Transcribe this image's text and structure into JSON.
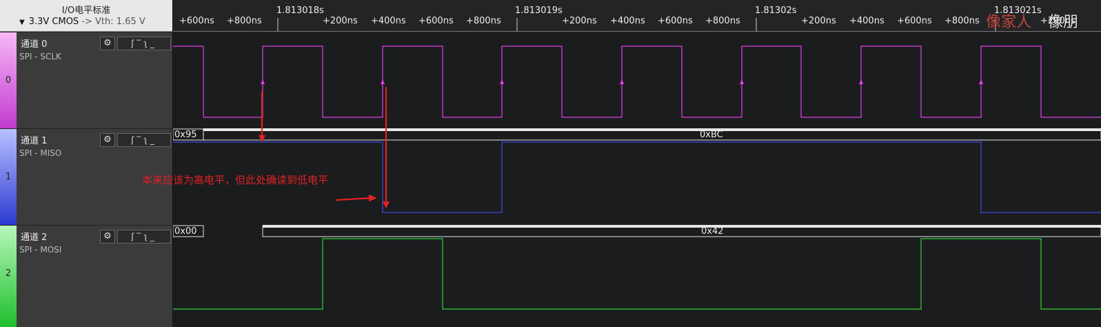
{
  "io_panel": {
    "title": "I/O电平标准",
    "standard": "3.3V CMOS",
    "vth": "-> Vth: 1.65 V"
  },
  "channels": [
    {
      "index": "0",
      "name": "通道 0",
      "signal": "SPI - SCLK",
      "color": "#e040e8"
    },
    {
      "index": "1",
      "name": "通道 1",
      "signal": "SPI - MISO",
      "color": "#3a4de0"
    },
    {
      "index": "2",
      "name": "通道 2",
      "signal": "SPI - MOSI",
      "color": "#2fd43a"
    }
  ],
  "trigger_icons": [
    "rising-edge-icon",
    "high-level-icon",
    "falling-edge-icon",
    "low-level-icon"
  ],
  "ruler": {
    "major": [
      "1.813018s",
      "1.813019s",
      "1.81302s",
      "1.813021s"
    ],
    "minor": [
      "+600ns",
      "+800ns",
      "+200ns",
      "+400ns",
      "+600ns",
      "+800ns",
      "+200ns",
      "+400ns",
      "+600ns",
      "+800ns",
      "+200ns",
      "+400ns",
      "+600ns",
      "+800ns",
      "+200ns"
    ]
  },
  "decoded": {
    "miso": [
      "0x95",
      "0xBC"
    ],
    "mosi": [
      "0x00",
      "0x42"
    ]
  },
  "annotation": "本来应该为高电平，但此处确读到低电平",
  "watermark": {
    "red": "像家人",
    "white": "像朋"
  }
}
